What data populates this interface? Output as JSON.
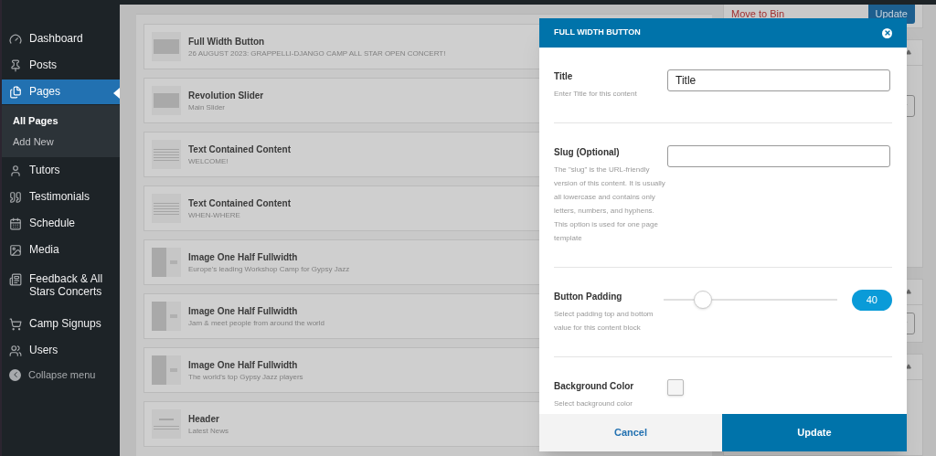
{
  "sidebar": {
    "items": [
      {
        "label": "Dashboard",
        "selected": false
      },
      {
        "label": "Posts",
        "selected": false
      },
      {
        "label": "Pages",
        "selected": true,
        "children": [
          {
            "label": "All Pages",
            "selected": true
          },
          {
            "label": "Add New",
            "selected": false
          }
        ]
      },
      {
        "label": "Tutors",
        "selected": false
      },
      {
        "label": "Testimonials",
        "selected": false
      },
      {
        "label": "Schedule",
        "selected": false
      },
      {
        "label": "Media",
        "selected": false
      },
      {
        "label": "Feedback & All Stars Concerts",
        "selected": false
      },
      {
        "label": "Camp Signups",
        "selected": false
      },
      {
        "label": "Users",
        "selected": false
      }
    ],
    "collapse": "Collapse menu"
  },
  "blocks": [
    {
      "kind": "button",
      "title": "Full Width Button",
      "subtitle": "26 AUGUST 2023: GRAPPELLI-DJANGO CAMP ALL STAR OPEN CONCERT!"
    },
    {
      "kind": "slider",
      "title": "Revolution Slider",
      "subtitle": "Main Slider"
    },
    {
      "kind": "text",
      "title": "Text Contained Content",
      "subtitle": "WELCOME!"
    },
    {
      "kind": "text",
      "title": "Text Contained Content",
      "subtitle": "WHEN-WHERE"
    },
    {
      "kind": "image",
      "title": "Image One Half Fullwidth",
      "subtitle": "Europe's leading Workshop Camp for Gypsy Jazz"
    },
    {
      "kind": "image",
      "title": "Image One Half Fullwidth",
      "subtitle": "Jam & meet people from around the world"
    },
    {
      "kind": "image",
      "title": "Image One Half Fullwidth",
      "subtitle": "The world's top Gypsy Jazz players"
    },
    {
      "kind": "header",
      "title": "Header",
      "subtitle": "Latest News"
    }
  ],
  "publish": {
    "move_to_bin": "Move to Bin",
    "update": "Update"
  },
  "modal": {
    "title": "FULL WIDTH BUTTON",
    "fields": [
      {
        "kind": "text",
        "label": "Title",
        "help": "Enter Title for this content",
        "value": "Title"
      },
      {
        "kind": "text",
        "label": "Slug (Optional)",
        "help": "The \"slug\" is the URL-friendly version of this content. It is usually all lowercase and contains only letters, numbers, and hyphens. This option is used for one page template"
      },
      {
        "kind": "slider",
        "label": "Button Padding",
        "help": "Select padding top and bottom value for this content block",
        "level": 0.23,
        "reading": "40"
      },
      {
        "kind": "color",
        "label": "Background Color",
        "help": "Select background color"
      }
    ],
    "cancel": "Cancel",
    "update": "Update"
  }
}
